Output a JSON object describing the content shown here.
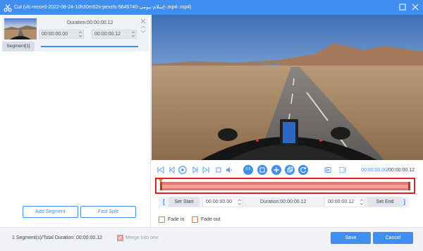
{
  "window": {
    "title": "Cut (vlc-record-2022-08-24-10h30m52s-pexels-5645740-إسلام-بيومى-.mp4-.mp4)"
  },
  "segment": {
    "duration": "Duration:00:00:00.12",
    "start_time": "00:00:00.00",
    "end_time": "00:00:00.12",
    "label": "Segment[1]"
  },
  "left_buttons": {
    "add_segment": "Add Segment",
    "fast_split": "Fast Split"
  },
  "player": {
    "current_time": "00:00:00.00",
    "total_time": "/00:00:00.12",
    "speed_badge": "0.5"
  },
  "trim": {
    "set_start": "Set Start",
    "start_time": "00:00:00.00",
    "duration": "Duration:00:00:00.12",
    "end_time": "00:00:00.12",
    "set_end": "Set End"
  },
  "fade": {
    "fade_in": "Fade in",
    "fade_out": "Fade out"
  },
  "footer": {
    "status": "1 Segment(s)/Total Duration: 00:00:00.12",
    "merge": "Merge into one",
    "save": "Save",
    "cancel": "Cancel"
  },
  "colors": {
    "accent": "#3f8ef0",
    "highlight_border": "#e0201b",
    "timeline": "#e07a6e",
    "checkbox_border": "#e57a45"
  },
  "timeline": {
    "selection_start": 0.0,
    "selection_end": 1.0
  }
}
